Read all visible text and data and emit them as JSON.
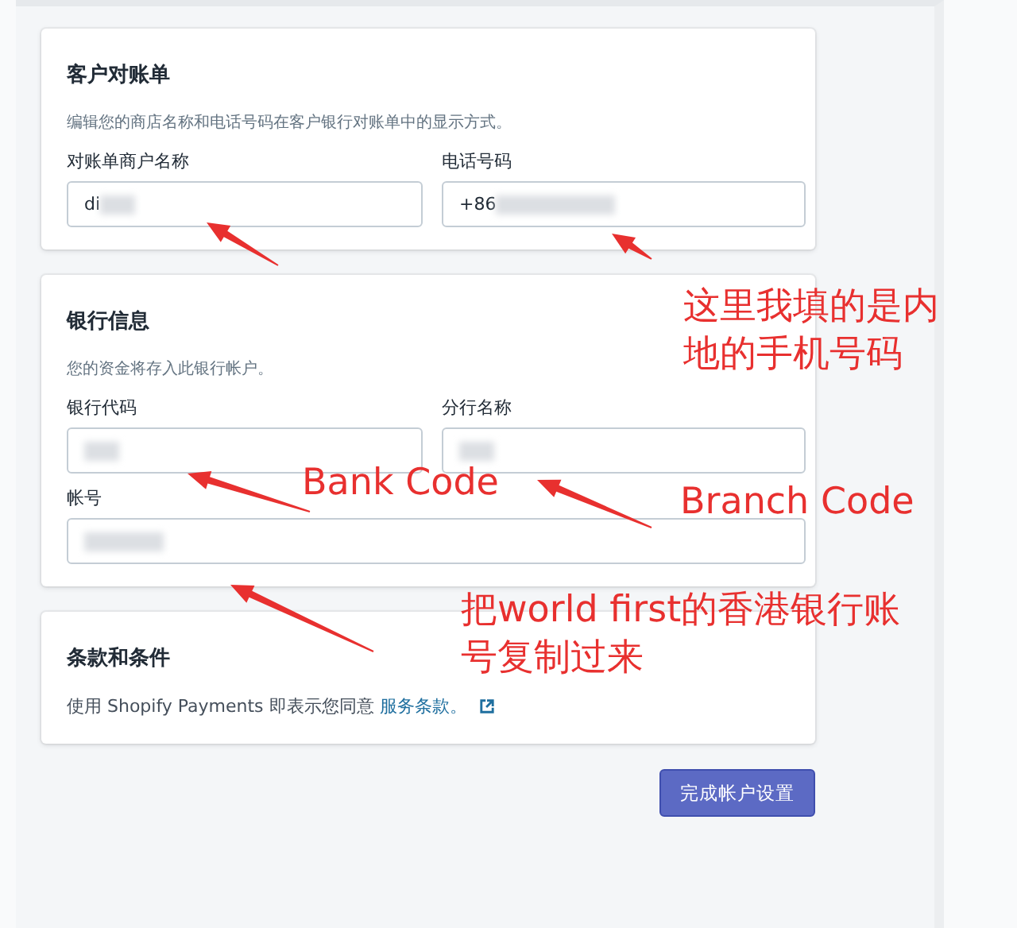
{
  "sections": [
    {
      "title": "客户对账单",
      "description": "编辑您的商店名称和电话号码在客户银行对账单中的显示方式。",
      "fields": [
        {
          "label": "对账单商户名称",
          "value": "di"
        },
        {
          "label": "电话号码",
          "value": "+86"
        }
      ]
    },
    {
      "title": "银行信息",
      "description": "您的资金将存入此银行帐户。",
      "fields": [
        {
          "label": "银行代码"
        },
        {
          "label": "分行名称"
        },
        {
          "label": "帐号"
        }
      ]
    }
  ],
  "terms": {
    "title": "条款和条件",
    "text": "使用 Shopify Payments 即表示您同意 ",
    "link": "服务条款。"
  },
  "button": "完成帐户设置",
  "annotations": [
    "这里我填的是内地的手机号码",
    "Bank Code",
    "Branch Code",
    "把world first的香港银行账号复制过来"
  ]
}
